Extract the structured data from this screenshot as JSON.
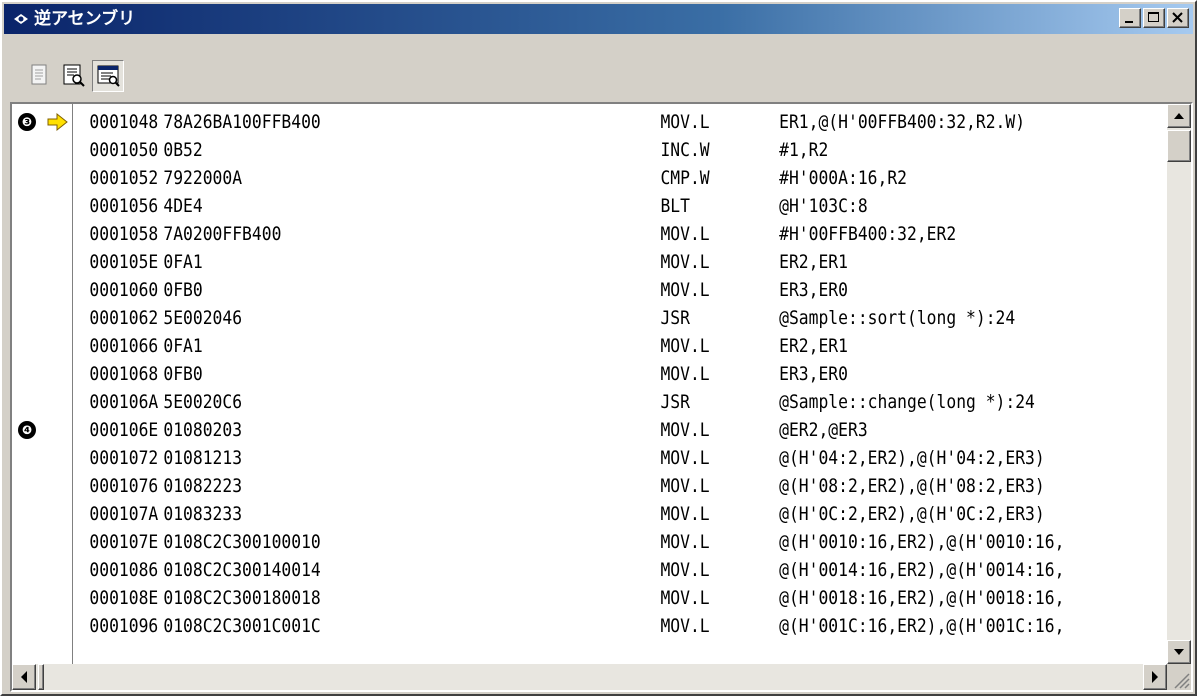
{
  "window": {
    "title": "逆アセンブリ"
  },
  "toolbar": {
    "buttons": [
      "list-view",
      "source-mixed-view",
      "disassembly-view"
    ]
  },
  "breakpoints": [
    {
      "label": "❸",
      "row": 0
    },
    {
      "label": "❹",
      "row": 11
    }
  ],
  "current_pc_row": 0,
  "rows": [
    {
      "address": "0001048",
      "code": "78A26BA100FFB400",
      "mnemonic": "MOV.L",
      "operands": "ER1,@(H'00FFB400:32,R2.W)"
    },
    {
      "address": "0001050",
      "code": "0B52",
      "mnemonic": "INC.W",
      "operands": "#1,R2"
    },
    {
      "address": "0001052",
      "code": "7922000A",
      "mnemonic": "CMP.W",
      "operands": "#H'000A:16,R2"
    },
    {
      "address": "0001056",
      "code": "4DE4",
      "mnemonic": "BLT",
      "operands": "@H'103C:8"
    },
    {
      "address": "0001058",
      "code": "7A0200FFB400",
      "mnemonic": "MOV.L",
      "operands": "#H'00FFB400:32,ER2"
    },
    {
      "address": "000105E",
      "code": "0FA1",
      "mnemonic": "MOV.L",
      "operands": "ER2,ER1"
    },
    {
      "address": "0001060",
      "code": "0FB0",
      "mnemonic": "MOV.L",
      "operands": "ER3,ER0"
    },
    {
      "address": "0001062",
      "code": "5E002046",
      "mnemonic": "JSR",
      "operands": "@Sample::sort(long *):24"
    },
    {
      "address": "0001066",
      "code": "0FA1",
      "mnemonic": "MOV.L",
      "operands": "ER2,ER1"
    },
    {
      "address": "0001068",
      "code": "0FB0",
      "mnemonic": "MOV.L",
      "operands": "ER3,ER0"
    },
    {
      "address": "000106A",
      "code": "5E0020C6",
      "mnemonic": "JSR",
      "operands": "@Sample::change(long *):24"
    },
    {
      "address": "000106E",
      "code": "01080203",
      "mnemonic": "MOV.L",
      "operands": "@ER2,@ER3"
    },
    {
      "address": "0001072",
      "code": "01081213",
      "mnemonic": "MOV.L",
      "operands": "@(H'04:2,ER2),@(H'04:2,ER3)"
    },
    {
      "address": "0001076",
      "code": "01082223",
      "mnemonic": "MOV.L",
      "operands": "@(H'08:2,ER2),@(H'08:2,ER3)"
    },
    {
      "address": "000107A",
      "code": "01083233",
      "mnemonic": "MOV.L",
      "operands": "@(H'0C:2,ER2),@(H'0C:2,ER3)"
    },
    {
      "address": "000107E",
      "code": "0108C2C300100010",
      "mnemonic": "MOV.L",
      "operands": "@(H'0010:16,ER2),@(H'0010:16,"
    },
    {
      "address": "0001086",
      "code": "0108C2C300140014",
      "mnemonic": "MOV.L",
      "operands": "@(H'0014:16,ER2),@(H'0014:16,"
    },
    {
      "address": "000108E",
      "code": "0108C2C300180018",
      "mnemonic": "MOV.L",
      "operands": "@(H'0018:16,ER2),@(H'0018:16,"
    },
    {
      "address": "0001096",
      "code": "0108C2C3001C001C",
      "mnemonic": "MOV.L",
      "operands": "@(H'001C:16,ER2),@(H'001C:16,"
    }
  ]
}
